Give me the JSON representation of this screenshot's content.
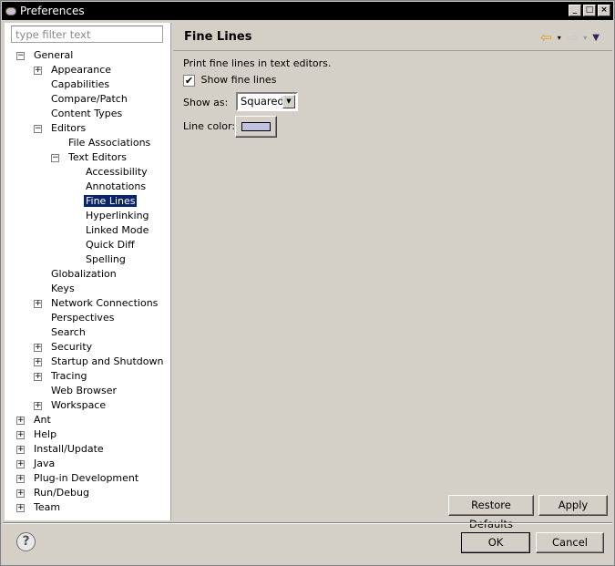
{
  "window": {
    "title": "Preferences",
    "minimize": "_",
    "maximize": "□",
    "close": "×"
  },
  "filter": {
    "placeholder": "type filter text"
  },
  "tree": [
    {
      "label": "General",
      "level": 0,
      "expander": "−"
    },
    {
      "label": "Appearance",
      "level": 1,
      "expander": "+"
    },
    {
      "label": "Capabilities",
      "level": 1,
      "expander": ""
    },
    {
      "label": "Compare/Patch",
      "level": 1,
      "expander": ""
    },
    {
      "label": "Content Types",
      "level": 1,
      "expander": ""
    },
    {
      "label": "Editors",
      "level": 1,
      "expander": "−"
    },
    {
      "label": "File Associations",
      "level": 2,
      "expander": ""
    },
    {
      "label": "Text Editors",
      "level": 2,
      "expander": "−"
    },
    {
      "label": "Accessibility",
      "level": 3,
      "expander": ""
    },
    {
      "label": "Annotations",
      "level": 3,
      "expander": ""
    },
    {
      "label": "Fine Lines",
      "level": 3,
      "expander": "",
      "selected": true
    },
    {
      "label": "Hyperlinking",
      "level": 3,
      "expander": ""
    },
    {
      "label": "Linked Mode",
      "level": 3,
      "expander": ""
    },
    {
      "label": "Quick Diff",
      "level": 3,
      "expander": ""
    },
    {
      "label": "Spelling",
      "level": 3,
      "expander": ""
    },
    {
      "label": "Globalization",
      "level": 1,
      "expander": ""
    },
    {
      "label": "Keys",
      "level": 1,
      "expander": ""
    },
    {
      "label": "Network Connections",
      "level": 1,
      "expander": "+"
    },
    {
      "label": "Perspectives",
      "level": 1,
      "expander": ""
    },
    {
      "label": "Search",
      "level": 1,
      "expander": ""
    },
    {
      "label": "Security",
      "level": 1,
      "expander": "+"
    },
    {
      "label": "Startup and Shutdown",
      "level": 1,
      "expander": "+"
    },
    {
      "label": "Tracing",
      "level": 1,
      "expander": "+"
    },
    {
      "label": "Web Browser",
      "level": 1,
      "expander": ""
    },
    {
      "label": "Workspace",
      "level": 1,
      "expander": "+"
    },
    {
      "label": "Ant",
      "level": 0,
      "expander": "+"
    },
    {
      "label": "Help",
      "level": 0,
      "expander": "+"
    },
    {
      "label": "Install/Update",
      "level": 0,
      "expander": "+"
    },
    {
      "label": "Java",
      "level": 0,
      "expander": "+"
    },
    {
      "label": "Plug-in Development",
      "level": 0,
      "expander": "+"
    },
    {
      "label": "Run/Debug",
      "level": 0,
      "expander": "+"
    },
    {
      "label": "Team",
      "level": 0,
      "expander": "+"
    }
  ],
  "page": {
    "title": "Fine Lines",
    "description": "Print fine lines in text editors.",
    "show_fine_lines_label": "Show fine lines",
    "show_fine_lines_checked": true,
    "show_as_label": "Show as:",
    "show_as_value": "Squared",
    "line_color_label": "Line color:",
    "line_color": "#c0c0e0",
    "restore_defaults": "Restore Defaults",
    "apply": "Apply"
  },
  "nav": {
    "back_icon": "⇦",
    "forward_icon": "⇨",
    "dropdown": "▾",
    "menu": "▼"
  },
  "footer": {
    "help": "?",
    "ok": "OK",
    "cancel": "Cancel"
  }
}
